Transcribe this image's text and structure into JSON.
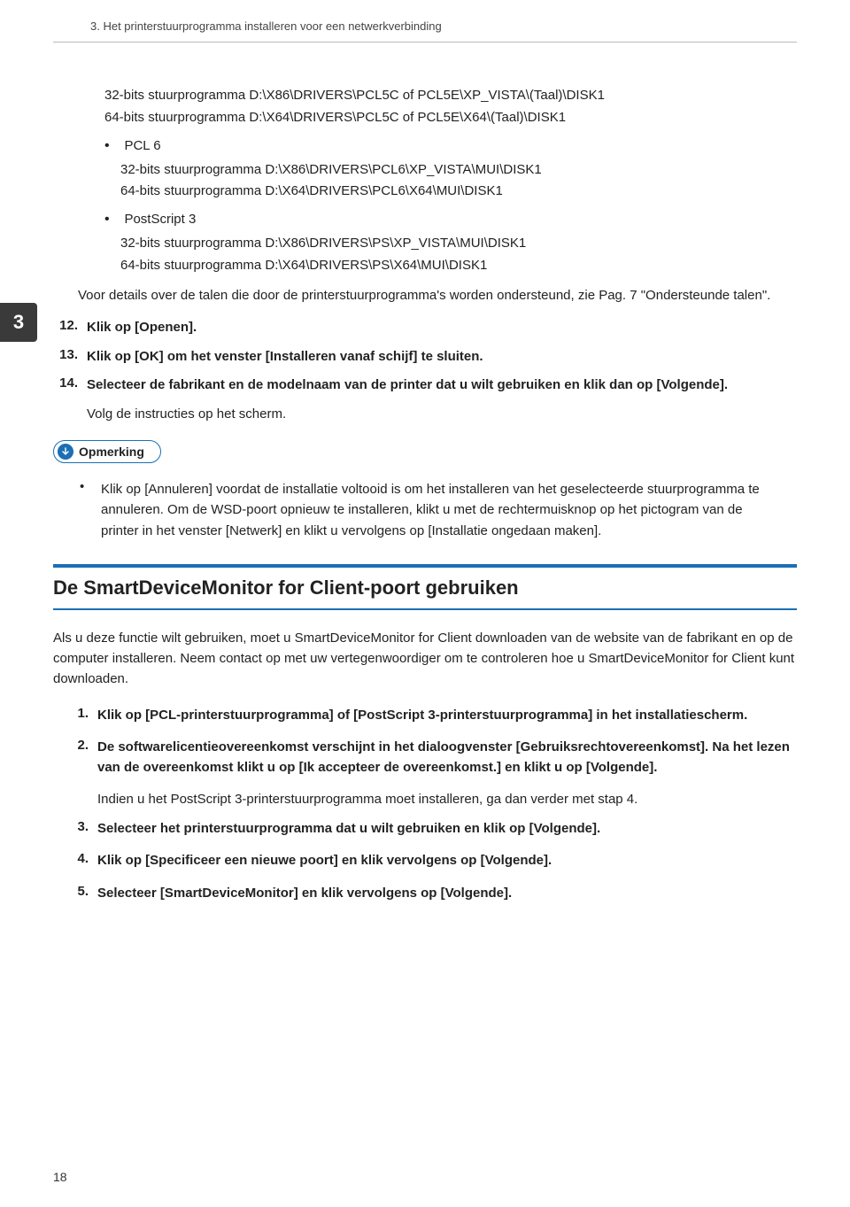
{
  "header": "3. Het printerstuurprogramma installeren voor een netwerkverbinding",
  "chapterTab": "3",
  "pageNumber": "18",
  "block1": {
    "paths": [
      "32-bits stuurprogramma D:\\X86\\DRIVERS\\PCL5C of PCL5E\\XP_VISTA\\(Taal)\\DISK1",
      "64-bits stuurprogramma D:\\X64\\DRIVERS\\PCL5C of PCL5E\\X64\\(Taal)\\DISK1"
    ],
    "sub1": {
      "label": "PCL 6",
      "paths": [
        "32-bits stuurprogramma D:\\X86\\DRIVERS\\PCL6\\XP_VISTA\\MUI\\DISK1",
        "64-bits stuurprogramma D:\\X64\\DRIVERS\\PCL6\\X64\\MUI\\DISK1"
      ]
    },
    "sub2": {
      "label": "PostScript 3",
      "paths": [
        "32-bits stuurprogramma D:\\X86\\DRIVERS\\PS\\XP_VISTA\\MUI\\DISK1",
        "64-bits stuurprogramma D:\\X64\\DRIVERS\\PS\\X64\\MUI\\DISK1"
      ]
    },
    "note": "Voor details over de talen die door de printerstuurprogramma's worden ondersteund, zie Pag. 7 \"Ondersteunde talen\"."
  },
  "stepsA": [
    {
      "n": "12.",
      "bold": true,
      "text": "Klik op [Openen]."
    },
    {
      "n": "13.",
      "bold": true,
      "text": "Klik op [OK] om het venster [Installeren vanaf schijf] te sluiten."
    },
    {
      "n": "14.",
      "bold": true,
      "text": "Selecteer de fabrikant en de modelnaam van de printer dat u wilt gebruiken en klik dan op [Volgende].",
      "sub": "Volg de instructies op het scherm."
    }
  ],
  "remark": {
    "label": "Opmerking",
    "body": "Klik op [Annuleren] voordat de installatie voltooid is om het installeren van het geselecteerde stuurprogramma te annuleren. Om de WSD-poort opnieuw te installeren, klikt u met de rechtermuisknop op het pictogram van de printer in het venster [Netwerk] en klikt u vervolgens op [Installatie ongedaan maken]."
  },
  "section2": {
    "title": "De SmartDeviceMonitor for Client-poort gebruiken",
    "intro": "Als u deze functie wilt gebruiken, moet u SmartDeviceMonitor for Client downloaden van de website van de fabrikant en op de computer installeren. Neem contact op met uw vertegenwoordiger om te controleren hoe u SmartDeviceMonitor for Client kunt downloaden.",
    "steps": [
      {
        "n": "1.",
        "bold": true,
        "text": "Klik op [PCL-printerstuurprogramma] of [PostScript 3-printerstuurprogramma] in het installatiescherm."
      },
      {
        "n": "2.",
        "bold": true,
        "text": "De softwarelicentieovereenkomst verschijnt in het dialoogvenster [Gebruiksrechtovereenkomst]. Na het lezen van de overeenkomst klikt u op [Ik accepteer de overeenkomst.] en klikt u op [Volgende].",
        "sub": "Indien u het PostScript 3-printerstuurprogramma moet installeren, ga dan verder met stap 4."
      },
      {
        "n": "3.",
        "bold": true,
        "text": "Selecteer het printerstuurprogramma dat u wilt gebruiken en klik op [Volgende]."
      },
      {
        "n": "4.",
        "bold": true,
        "text": "Klik op [Specificeer een nieuwe poort] en klik vervolgens op [Volgende]."
      },
      {
        "n": "5.",
        "bold": true,
        "text": "Selecteer [SmartDeviceMonitor] en klik vervolgens op [Volgende]."
      }
    ]
  }
}
